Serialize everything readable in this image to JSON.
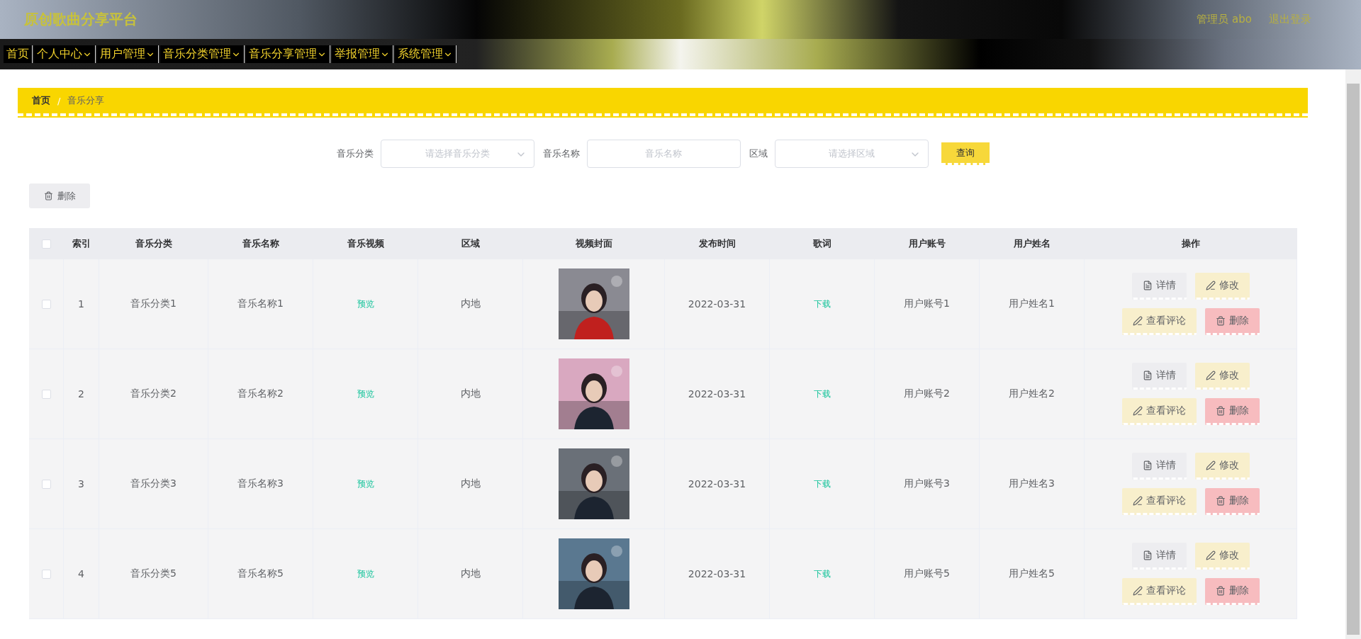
{
  "header": {
    "title": "原创歌曲分享平台",
    "user": "管理员 abo",
    "logout": "退出登录"
  },
  "nav": [
    {
      "label": "首页",
      "has_menu": false
    },
    {
      "label": "个人中心",
      "has_menu": true
    },
    {
      "label": "用户管理",
      "has_menu": true
    },
    {
      "label": "音乐分类管理",
      "has_menu": true
    },
    {
      "label": "音乐分享管理",
      "has_menu": true
    },
    {
      "label": "举报管理",
      "has_menu": true
    },
    {
      "label": "系统管理",
      "has_menu": true
    }
  ],
  "breadcrumb": [
    "首页",
    "音乐分享"
  ],
  "breadcrumb_separator": "/",
  "filters": [
    {
      "label": "音乐分类",
      "kind": "select",
      "placeholder": "请选择音乐分类"
    },
    {
      "label": "音乐名称",
      "kind": "input",
      "placeholder": "音乐名称"
    },
    {
      "label": "区域",
      "kind": "select",
      "placeholder": "请选择区域"
    }
  ],
  "search_button": "查询",
  "delete_button": "删除",
  "table": {
    "select_all_checked": false,
    "columns": [
      "索引",
      "音乐分类",
      "音乐名称",
      "音乐视频",
      "区域",
      "视频封面",
      "发布时间",
      "歌词",
      "用户账号",
      "用户姓名",
      "操作"
    ],
    "rows": [
      {
        "checked": false,
        "index": "1",
        "category": "音乐分类1",
        "name": "音乐名称1",
        "video": "预览",
        "region": "内地",
        "date": "2022-03-31",
        "lyrics": "下载",
        "account": "用户账号1",
        "username": "用户姓名1",
        "actions": [
          "详情",
          "修改",
          "查看评论",
          "删除"
        ]
      },
      {
        "checked": false,
        "index": "2",
        "category": "音乐分类2",
        "name": "音乐名称2",
        "video": "预览",
        "region": "内地",
        "date": "2022-03-31",
        "lyrics": "下载",
        "account": "用户账号2",
        "username": "用户姓名2",
        "actions": [
          "详情",
          "修改",
          "查看评论",
          "删除"
        ]
      },
      {
        "checked": false,
        "index": "3",
        "category": "音乐分类3",
        "name": "音乐名称3",
        "video": "预览",
        "region": "内地",
        "date": "2022-03-31",
        "lyrics": "下载",
        "account": "用户账号3",
        "username": "用户姓名3",
        "actions": [
          "详情",
          "修改",
          "查看评论",
          "删除"
        ]
      },
      {
        "checked": false,
        "index": "4",
        "category": "音乐分类5",
        "name": "音乐名称5",
        "video": "预览",
        "region": "内地",
        "date": "2022-03-31",
        "lyrics": "下载",
        "account": "用户账号5",
        "username": "用户姓名5",
        "actions": [
          "详情",
          "修改",
          "查看评论",
          "删除"
        ]
      }
    ]
  }
}
